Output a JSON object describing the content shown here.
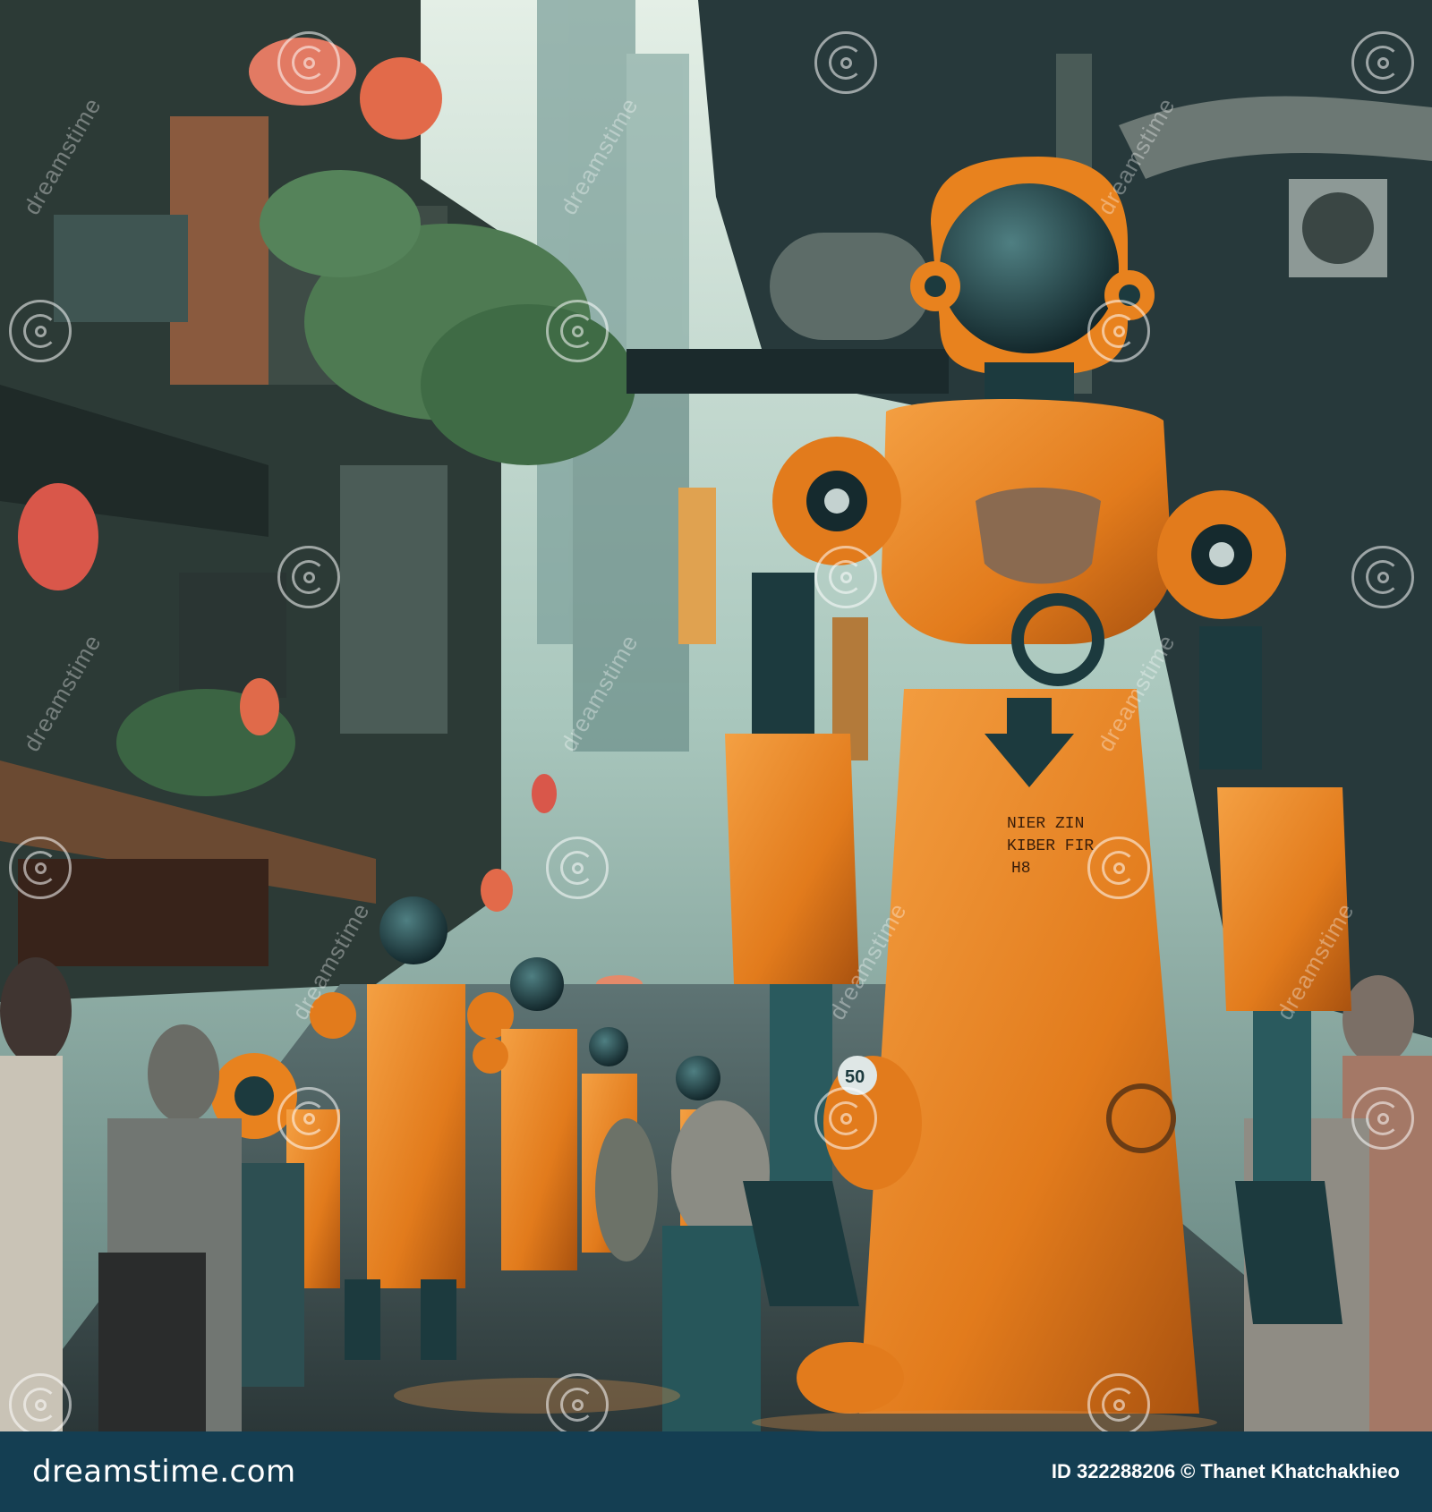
{
  "scene": {
    "subject": "orange-robots-in-street",
    "colors": {
      "sky": "#cfe2d8",
      "haze": "#9dbcb4",
      "building_dark": "#2a3b3c",
      "foliage": "#3f6b45",
      "robot_orange": "#e8821e",
      "robot_dark": "#1c3a3e",
      "lantern": "#e06a4a",
      "street": "#3a4a4c"
    },
    "robot_chest_text": [
      "NIER ZIN",
      "KIBER FIR",
      "H8"
    ],
    "robot_arm_badge": "50"
  },
  "watermark": {
    "brand": "dreamstime"
  },
  "footer": {
    "logo": "dreamstime.com",
    "credit": "ID 322288206 © Thanet Khatchakhieo",
    "background": "#143e52"
  }
}
